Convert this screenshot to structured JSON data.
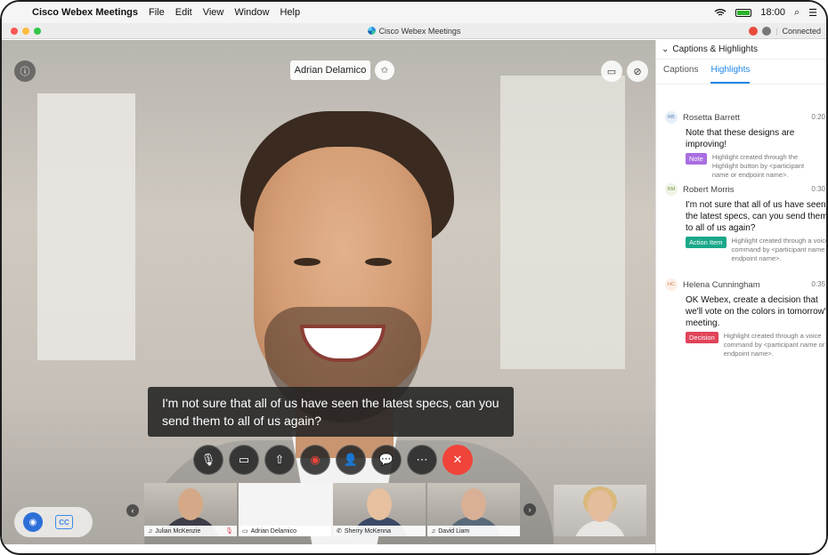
{
  "menubar": {
    "app": "Cisco Webex Meetings",
    "items": [
      "File",
      "Edit",
      "View",
      "Window",
      "Help"
    ],
    "clock": "18:00"
  },
  "window": {
    "title": "Cisco Webex Meetings",
    "status": "Connected"
  },
  "video": {
    "speaker_name": "Adrian Delamico",
    "caption": "I'm not sure that all of us have seen the latest specs, can you send them to all of us again?"
  },
  "thumbnails": [
    {
      "name": "Julian McKenzie"
    },
    {
      "name": "Adrian Delamico"
    },
    {
      "name": "Sherry McKenna"
    },
    {
      "name": "David Liam"
    }
  ],
  "panel": {
    "title": "Captions & Highlights",
    "tabs": [
      "Captions",
      "Highlights"
    ],
    "entries": [
      {
        "initials": "RB",
        "name": "Rosetta Barrett",
        "time": "0:20",
        "text": "Note that these designs are improving!",
        "tag": "Note",
        "tag_color": "#a86ee0",
        "note": "Highlight created through the Highlight button by <participant name or endpoint name>."
      },
      {
        "initials": "RM",
        "name": "Robert Morris",
        "time": "0:30",
        "text": "I'm not sure that all of us have seen the latest specs, can you send them to all of us again?",
        "tag": "Action Item",
        "tag_color": "#1aa88a",
        "note": "Highlight created through a voice command by <participant name or endpoint name>."
      },
      {
        "initials": "HC",
        "name": "Helena Cunningham",
        "time": "0:35",
        "text": "OK Webex, create a decision that we'll vote on the colors in tomorrow's meeting.",
        "tag": "Decision",
        "tag_color": "#e0445a",
        "note": "Highlight created through a voice command by <participant name or endpoint name>."
      }
    ]
  },
  "icons": {
    "controls": [
      "mic-muted-icon",
      "video-off-icon",
      "share-icon",
      "record-icon",
      "participants-icon",
      "chat-icon",
      "more-icon",
      "end-call-icon"
    ]
  }
}
